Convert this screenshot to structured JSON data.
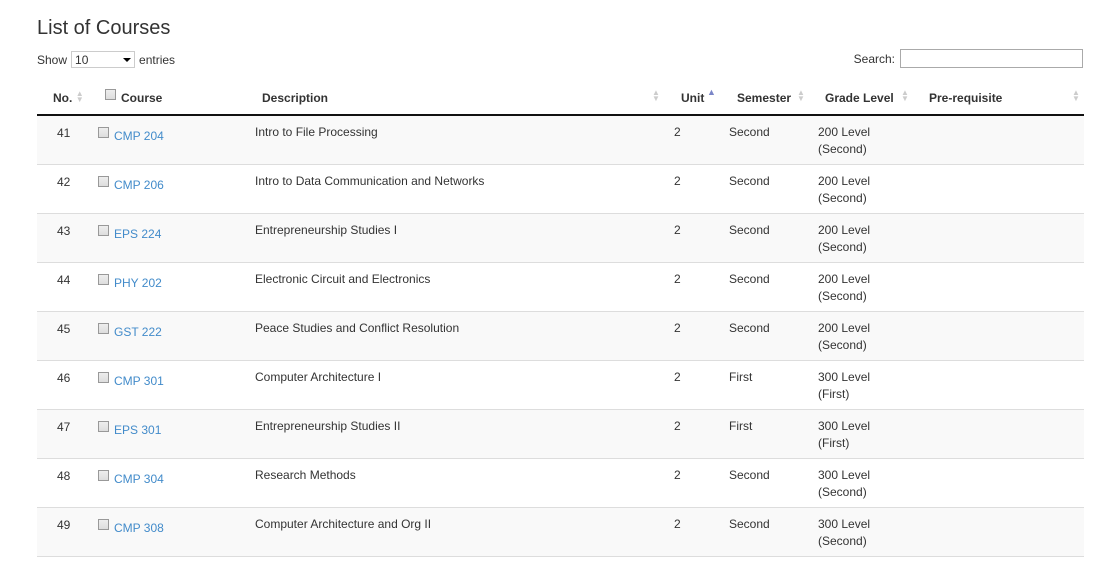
{
  "title": "List of Courses",
  "length": {
    "show": "Show",
    "value": "10",
    "entries": "entries"
  },
  "search": {
    "label": "Search:",
    "value": ""
  },
  "columns": {
    "no": "No.",
    "course": "Course",
    "description": "Description",
    "unit": "Unit",
    "semester": "Semester",
    "grade": "Grade Level",
    "prereq": "Pre-requisite"
  },
  "sort": {
    "column": "Unit",
    "direction": "ascending"
  },
  "rows": [
    {
      "no": "41",
      "course": "CMP 204",
      "description": "Intro to File Processing",
      "unit": "2",
      "semester": "Second",
      "grade1": "200 Level",
      "grade2": "(Second)",
      "prereq": ""
    },
    {
      "no": "42",
      "course": "CMP 206",
      "description": "Intro to Data Communication and Networks",
      "unit": "2",
      "semester": "Second",
      "grade1": "200 Level",
      "grade2": "(Second)",
      "prereq": ""
    },
    {
      "no": "43",
      "course": "EPS 224",
      "description": "Entrepreneurship Studies I",
      "unit": "2",
      "semester": "Second",
      "grade1": "200 Level",
      "grade2": "(Second)",
      "prereq": ""
    },
    {
      "no": "44",
      "course": "PHY 202",
      "description": "Electronic Circuit and Electronics",
      "unit": "2",
      "semester": "Second",
      "grade1": "200 Level",
      "grade2": "(Second)",
      "prereq": ""
    },
    {
      "no": "45",
      "course": "GST 222",
      "description": "Peace Studies and Conflict Resolution",
      "unit": "2",
      "semester": "Second",
      "grade1": "200 Level",
      "grade2": "(Second)",
      "prereq": ""
    },
    {
      "no": "46",
      "course": "CMP 301",
      "description": "Computer Architecture I",
      "unit": "2",
      "semester": "First",
      "grade1": "300 Level",
      "grade2": "(First)",
      "prereq": ""
    },
    {
      "no": "47",
      "course": "EPS 301",
      "description": "Entrepreneurship Studies II",
      "unit": "2",
      "semester": "First",
      "grade1": "300 Level",
      "grade2": "(First)",
      "prereq": ""
    },
    {
      "no": "48",
      "course": "CMP 304",
      "description": "Research Methods",
      "unit": "2",
      "semester": "Second",
      "grade1": "300 Level",
      "grade2": "(Second)",
      "prereq": ""
    },
    {
      "no": "49",
      "course": "CMP 308",
      "description": "Computer Architecture and Org II",
      "unit": "2",
      "semester": "Second",
      "grade1": "300 Level",
      "grade2": "(Second)",
      "prereq": ""
    }
  ]
}
